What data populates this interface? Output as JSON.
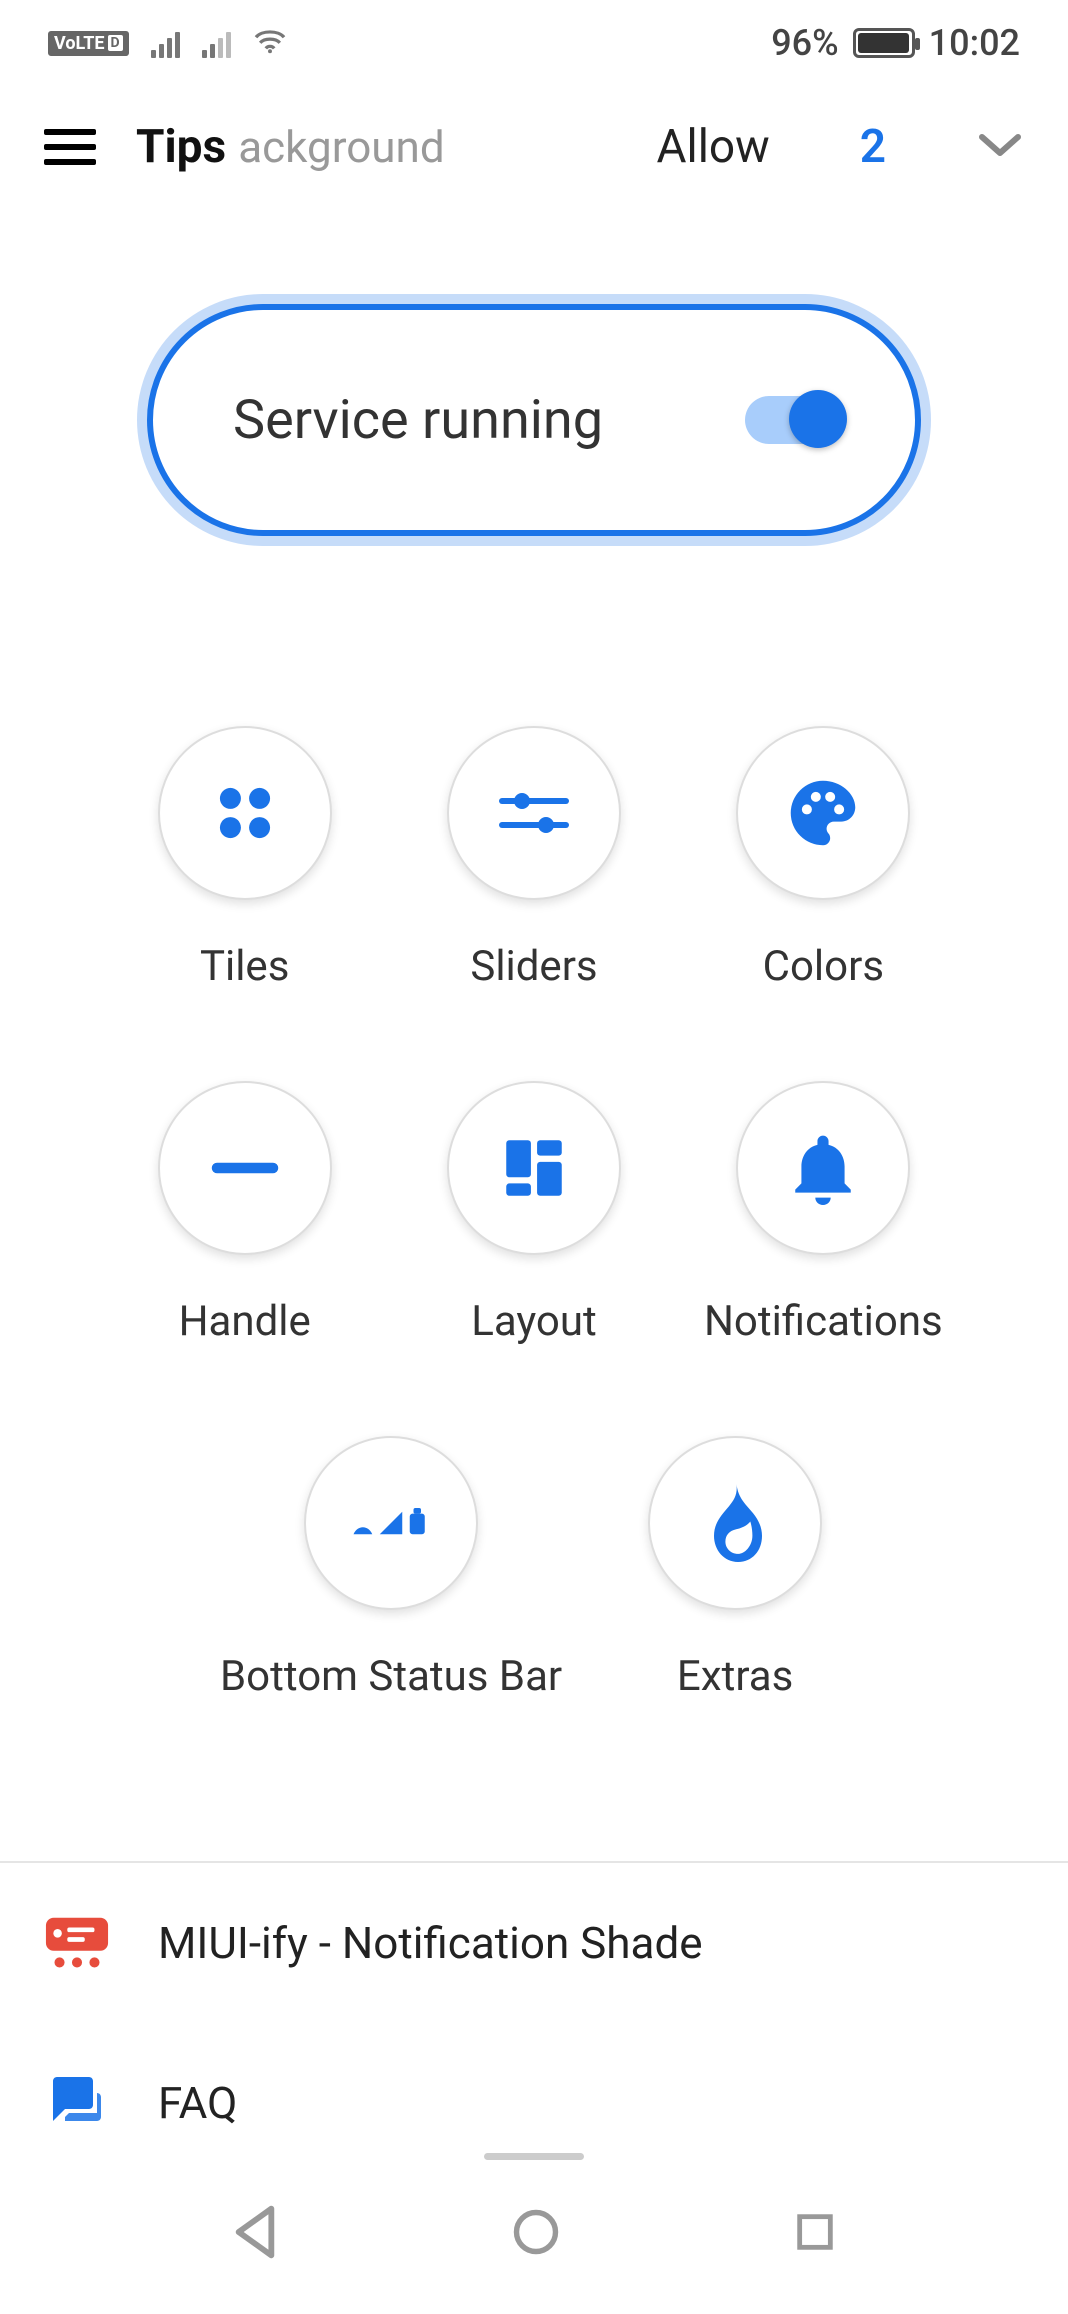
{
  "status_bar": {
    "volte": "VoLTE",
    "volte_d": "D",
    "battery_pct": "96%",
    "time": "10:02"
  },
  "header": {
    "menu_icon": "menu-icon",
    "title": "Tips",
    "subtitle_fragment": "ackground",
    "allow": "Allow",
    "count": "2",
    "chevron": "chevron-down-icon"
  },
  "service": {
    "label": "Service running",
    "enabled": true
  },
  "grid": {
    "items": [
      {
        "label": "Tiles",
        "icon": "tiles-icon"
      },
      {
        "label": "Sliders",
        "icon": "sliders-icon"
      },
      {
        "label": "Colors",
        "icon": "palette-icon"
      },
      {
        "label": "Handle",
        "icon": "handle-icon"
      },
      {
        "label": "Layout",
        "icon": "layout-icon"
      },
      {
        "label": "Notifications",
        "icon": "bell-icon"
      }
    ],
    "row2": [
      {
        "label": "Bottom Status Bar",
        "icon": "status-bar-icon"
      },
      {
        "label": "Extras",
        "icon": "flame-icon"
      }
    ]
  },
  "list": {
    "items": [
      {
        "label": "MIUI-ify - Notification Shade",
        "icon": "miui-card-icon"
      },
      {
        "label": "FAQ",
        "icon": "chat-icon"
      }
    ]
  },
  "colors": {
    "primary": "#1a73e8",
    "accent_red": "#e74c3c"
  }
}
